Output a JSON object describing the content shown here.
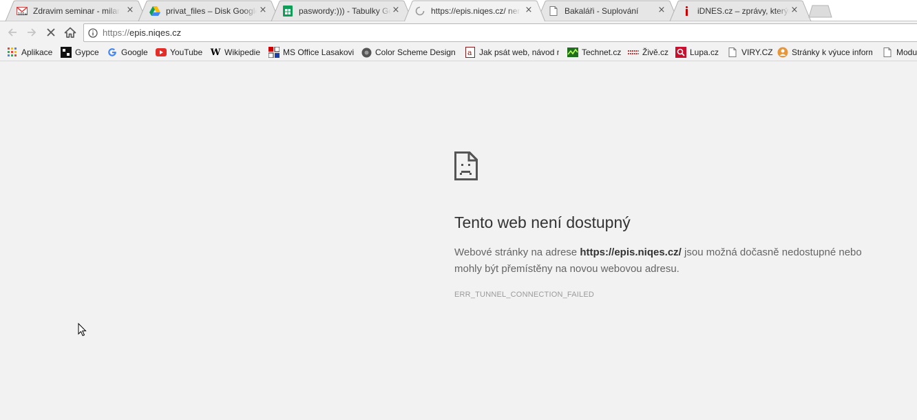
{
  "tabs": [
    {
      "title": "Zdravim seminar - milan",
      "icon": "gmail-icon",
      "close": "×"
    },
    {
      "title": "privat_files – Disk Google",
      "icon": "google-drive-icon",
      "close": "×"
    },
    {
      "title": "paswordy:))) - Tabulky Go",
      "icon": "google-sheets-icon",
      "close": "×"
    },
    {
      "title": "https://epis.niqes.cz/ nen",
      "icon": "loading-spinner-icon",
      "close": "×",
      "active": true
    },
    {
      "title": "Bakaláři - Suplování",
      "icon": "page-icon",
      "close": "×"
    },
    {
      "title": "iDNES.cz – zprávy, kterým",
      "icon": "idnes-icon",
      "close": "×"
    }
  ],
  "toolbar": {
    "back": "back-arrow-icon",
    "forward": "forward-arrow-icon",
    "stop": "stop-icon",
    "home": "home-icon"
  },
  "omnibox": {
    "scheme": "https://",
    "host": "epis.niqes.cz"
  },
  "bookmarks": [
    {
      "label": "Aplikace",
      "icon": "apps-grid-icon"
    },
    {
      "label": "Gypce",
      "icon": "gypce-icon"
    },
    {
      "label": "Google",
      "icon": "google-icon"
    },
    {
      "label": "YouTube",
      "icon": "youtube-icon"
    },
    {
      "label": "Wikipedie",
      "icon": "wikipedia-icon"
    },
    {
      "label": "MS Office Lasakovi",
      "icon": "ms-office-icon"
    },
    {
      "label": "Color Scheme Designe",
      "icon": "color-scheme-icon"
    },
    {
      "label": "Jak psát web, návod n",
      "icon": "jak-psat-web-icon"
    },
    {
      "label": "Technet.cz",
      "icon": "technet-icon"
    },
    {
      "label": "Živě.cz",
      "icon": "zive-icon"
    },
    {
      "label": "Lupa.cz",
      "icon": "lupa-icon"
    },
    {
      "label": "VIRY.CZ",
      "icon": "page-icon"
    },
    {
      "label": "Stránky k výuce inform",
      "icon": "vyuka-icon"
    },
    {
      "label": "Modu",
      "icon": "page-icon"
    }
  ],
  "error": {
    "icon": "sad-page-icon",
    "title": "Tento web není dostupný",
    "desc_before": "Webové stránky na adrese ",
    "desc_url": "https://epis.niqes.cz/",
    "desc_after": " jsou možná dočasně nedostupné nebo mohly být přemístěny na novou webovou adresu.",
    "code": "ERR_TUNNEL_CONNECTION_FAILED"
  },
  "colors": {
    "page_bg": "#f2f2f2",
    "tab_inactive": "#e6e6e6",
    "tab_active": "#f2f2f2",
    "youtube_red": "#e52d27",
    "lupa_red": "#c8102e",
    "technet_green": "#2e8b2e"
  }
}
